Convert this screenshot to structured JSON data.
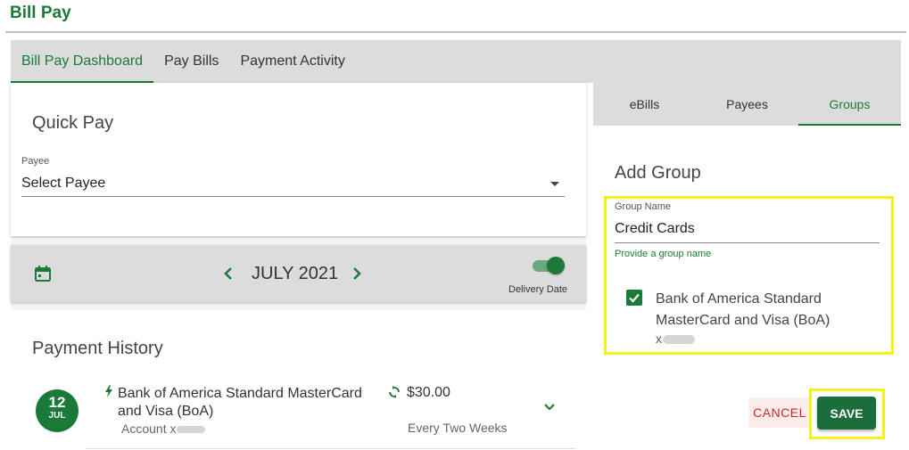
{
  "app": {
    "title": "Bill Pay"
  },
  "top_tabs": [
    {
      "label": "Bill Pay Dashboard",
      "active": true
    },
    {
      "label": "Pay Bills",
      "active": false
    },
    {
      "label": "Payment Activity",
      "active": false
    }
  ],
  "quick_pay": {
    "title": "Quick Pay",
    "payee_label": "Payee",
    "payee_value": "Select Payee"
  },
  "date_nav": {
    "month": "JULY 2021",
    "delivery_label": "Delivery Date",
    "toggle_on": true
  },
  "payment_history": {
    "title": "Payment History",
    "items": [
      {
        "day": "12",
        "month": "JUL",
        "payee": "Bank of America Standard MasterCard and Visa (BoA)",
        "account_prefix": "Account x",
        "amount": "$30.00",
        "frequency": "Every Two Weeks"
      }
    ]
  },
  "side_tabs": [
    {
      "label": "eBills",
      "active": false
    },
    {
      "label": "Payees",
      "active": false
    },
    {
      "label": "Groups",
      "active": true
    }
  ],
  "add_group": {
    "title": "Add Group",
    "name_label": "Group Name",
    "name_value": "Credit Cards",
    "helper": "Provide a group name",
    "payee_option": "Bank of America Standard MasterCard and Visa (BoA)",
    "payee_option_account": "x",
    "payee_checked": true,
    "cancel_label": "CANCEL",
    "save_label": "SAVE"
  },
  "colors": {
    "brand_green": "#1b7a3a",
    "highlight": "#f5ef1a",
    "cancel_red": "#c62828"
  },
  "icons": [
    "calendar-icon",
    "chevron-left-icon",
    "chevron-right-icon",
    "bolt-icon",
    "recurring-icon",
    "chevron-down-icon",
    "checkmark-icon"
  ]
}
